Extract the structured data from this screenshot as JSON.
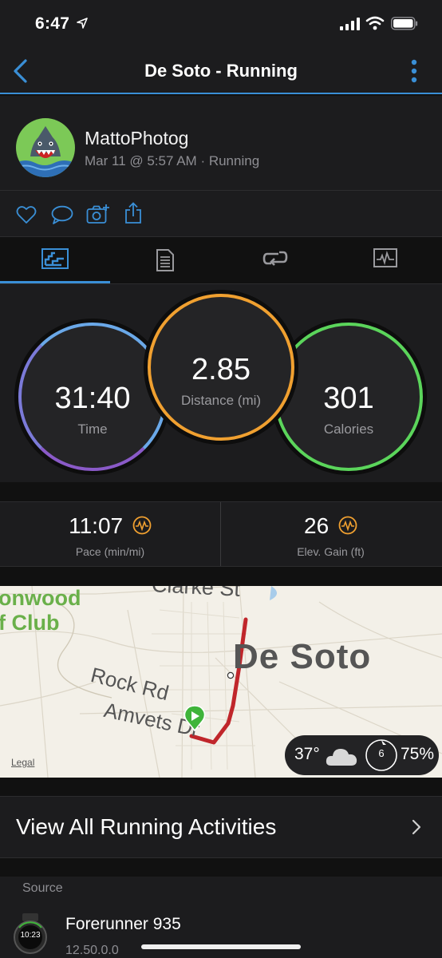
{
  "status_bar": {
    "time": "6:47"
  },
  "nav": {
    "title": "De Soto - Running"
  },
  "activity": {
    "user_name": "MattoPhotog",
    "meta": "Mar 11 @ 5:57 AM · Running"
  },
  "tabs": [
    {
      "name": "summary",
      "icon": "stats-chart-icon",
      "active": true
    },
    {
      "name": "details",
      "icon": "document-icon",
      "active": false
    },
    {
      "name": "laps",
      "icon": "laps-loop-icon",
      "active": false
    },
    {
      "name": "charts",
      "icon": "chart-graph-icon",
      "active": false
    }
  ],
  "stats": {
    "time": {
      "value": "31:40",
      "label": "Time",
      "color": "#6aa8e8"
    },
    "distance": {
      "value": "2.85",
      "label": "Distance (mi)",
      "color": "#f0a030"
    },
    "calories": {
      "value": "301",
      "label": "Calories",
      "color": "#5bd55b"
    }
  },
  "metrics": {
    "pace": {
      "value": "11:07",
      "label": "Pace (min/mi)"
    },
    "elevation": {
      "value": "26",
      "label": "Elev. Gain (ft)"
    }
  },
  "map": {
    "labels": {
      "club_line1": "onwood",
      "club_line2": "f Club",
      "street_top": "Clarke St",
      "town": "De Soto",
      "road1": "Rock Rd",
      "road2": "Amvets Dr"
    },
    "legal": "Legal",
    "weather": {
      "temp": "37°",
      "wind": "6",
      "humidity": "75%"
    }
  },
  "list": {
    "view_all": "View All Running Activities"
  },
  "source": {
    "header": "Source",
    "device_name": "Forerunner 935",
    "version": "12.50.0.0",
    "watch_face_time": "10:23"
  },
  "colors": {
    "accent": "#3a8fd6",
    "route": "#c0262b",
    "start_marker": "#3fb43a",
    "metric_icon": "#f0a030"
  }
}
